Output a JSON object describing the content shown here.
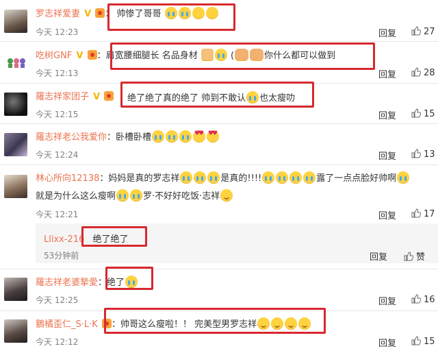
{
  "comments": [
    {
      "user": "罗志祥爱妻",
      "text": "帅惨了哥哥",
      "time": "今天 12:23",
      "reply": "回复",
      "likes": "27"
    },
    {
      "user": "吃树GNF",
      "text": "肩宽腰细腿长 名品身材",
      "text2": "你什么都可以做到",
      "time": "今天 12:13",
      "reply": "回复",
      "likes": "28"
    },
    {
      "user": "羅志祥家团子",
      "text": "绝了绝了真的绝了 帅到不敢认",
      "text2": "也太瘦叻",
      "time": "今天 12:15",
      "reply": "回复",
      "likes": "15"
    },
    {
      "user": "羅志祥老公我爱你",
      "text": "卧槽卧槽",
      "time": "今天 12:24",
      "reply": "回复",
      "likes": "13"
    },
    {
      "user": "林心所向12138",
      "text": "妈妈是真的罗志祥",
      "text2": "是真的!!!!",
      "text3": "露了一点点脸好帅啊",
      "text4": "就是为什么这么瘦啊",
      "text5": "罗·不好好吃饭·志祥",
      "time": "今天 12:21",
      "reply": "回复",
      "likes": "17"
    },
    {
      "user": "羅志祥老婆摯愛",
      "text": "绝了",
      "time": "今天 12:25",
      "reply": "回复",
      "likes": "16"
    },
    {
      "user": "鵝橘歪仁_S·L·K",
      "text": "帅哥这么瘦啦！！ 完美型男罗志祥",
      "time": "今天 12:12",
      "reply": "回复",
      "likes": "15"
    }
  ],
  "subreply": {
    "user": "Llixx-216",
    "text": "绝了绝了",
    "time": "53分钟前",
    "reply": "回复",
    "like": "赞"
  }
}
